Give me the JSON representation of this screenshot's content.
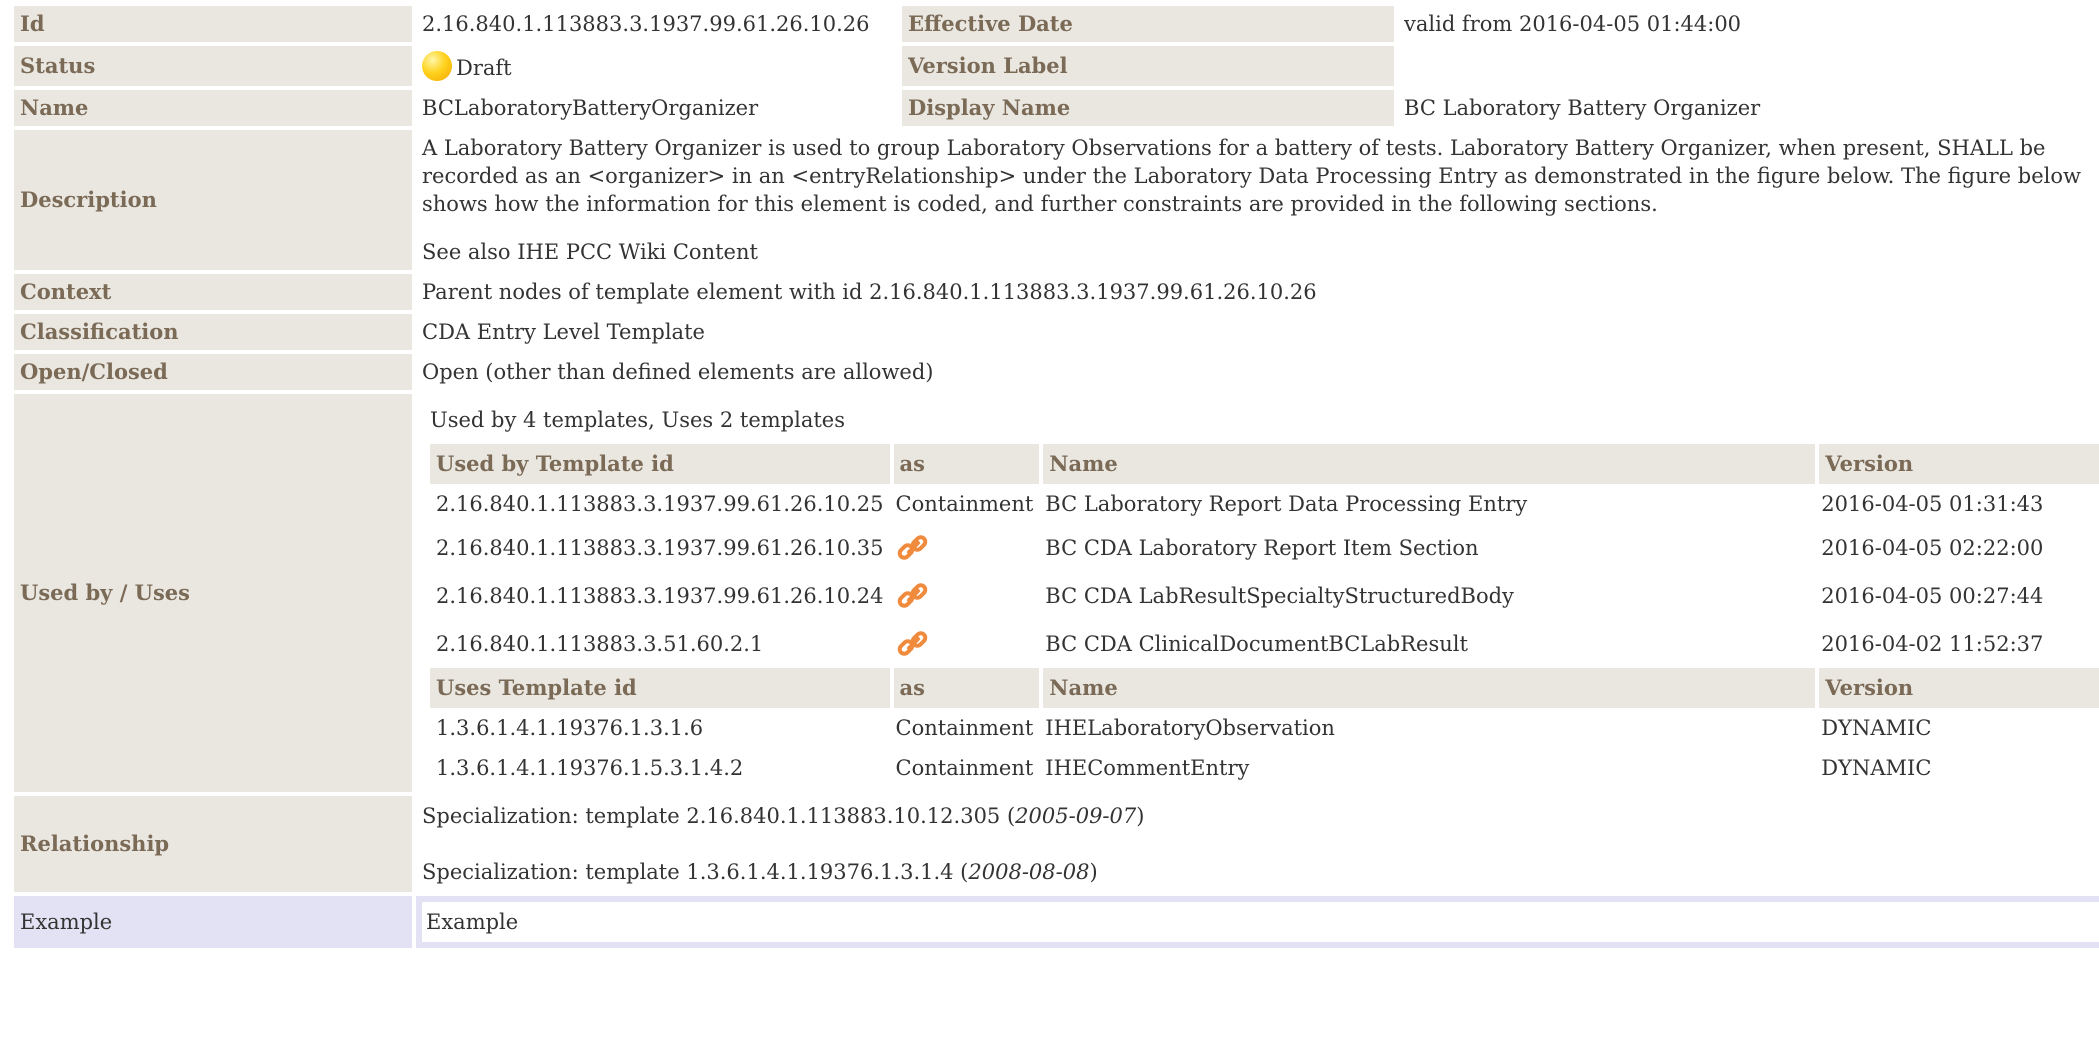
{
  "rows": {
    "id": {
      "label": "Id",
      "value": "2.16.840.1.113883.3.1937.99.61.26.10.26",
      "label2": "Effective Date",
      "value2": "valid from 2016-04-05 01:44:00"
    },
    "status": {
      "label": "Status",
      "value": "Draft",
      "label2": "Version Label",
      "value2": ""
    },
    "name": {
      "label": "Name",
      "value": "BCLaboratoryBatteryOrganizer",
      "label2": "Display Name",
      "value2": "BC Laboratory Battery Organizer"
    },
    "description": {
      "label": "Description",
      "text": "A Laboratory Battery Organizer is used to group Laboratory Observations for a battery of tests. Laboratory Battery Organizer, when present, SHALL be recorded as an <organizer> in an <entryRelationship> under the Laboratory Data Processing Entry as demonstrated in the figure below. The figure below shows how the information for this element is coded, and further constraints are provided in the following sections.",
      "see_also": "See also IHE PCC Wiki Content"
    },
    "context": {
      "label": "Context",
      "value": "Parent nodes of template element with id 2.16.840.1.113883.3.1937.99.61.26.10.26"
    },
    "classification": {
      "label": "Classification",
      "value": "CDA Entry Level Template"
    },
    "open_closed": {
      "label": "Open/Closed",
      "value": "Open (other than defined elements are allowed)"
    },
    "used_by": {
      "label": "Used by / Uses",
      "summary": "Used by 4 templates, Uses 2 templates",
      "used_by_headers": [
        "Used by Template id",
        "as",
        "Name",
        "Version"
      ],
      "used_by_rows": [
        {
          "id": "2.16.840.1.113883.3.1937.99.61.26.10.25",
          "as": "Containment",
          "name": "BC Laboratory Report Data Processing Entry",
          "version": "2016-04-05 01:31:43"
        },
        {
          "id": "2.16.840.1.113883.3.1937.99.61.26.10.35",
          "as": "",
          "as_icon": "link-icon",
          "name": "BC CDA Laboratory Report Item Section",
          "version": "2016-04-05 02:22:00"
        },
        {
          "id": "2.16.840.1.113883.3.1937.99.61.26.10.24",
          "as": "",
          "as_icon": "link-icon",
          "name": "BC CDA LabResultSpecialtyStructuredBody",
          "version": "2016-04-05 00:27:44"
        },
        {
          "id": "2.16.840.1.113883.3.51.60.2.1",
          "as": "",
          "as_icon": "link-icon",
          "name": "BC CDA ClinicalDocumentBCLabResult",
          "version": "2016-04-02 11:52:37"
        }
      ],
      "uses_headers": [
        "Uses Template id",
        "as",
        "Name",
        "Version"
      ],
      "uses_rows": [
        {
          "id": "1.3.6.1.4.1.19376.1.3.1.6",
          "as": "Containment",
          "name": "IHELaboratoryObservation",
          "version": "DYNAMIC"
        },
        {
          "id": "1.3.6.1.4.1.19376.1.5.3.1.4.2",
          "as": "Containment",
          "name": "IHECommentEntry",
          "version": "DYNAMIC"
        }
      ]
    },
    "relationship": {
      "label": "Relationship",
      "items": [
        {
          "prefix": "Specialization: template 2.16.840.1.113883.10.12.305 (",
          "date": "2005-09-07",
          "suffix": ")"
        },
        {
          "prefix": "Specialization: template 1.3.6.1.4.1.19376.1.3.1.4 (",
          "date": "2008-08-08",
          "suffix": ")"
        }
      ]
    },
    "example": {
      "label": "Example",
      "value": "Example"
    }
  },
  "colors": {
    "label_bg": "#eae7e1",
    "label_text": "#7a6a56",
    "example_bg": "#e2e2f4",
    "status_dot": "#ffd21e",
    "link_icon": "#f08a3c"
  }
}
